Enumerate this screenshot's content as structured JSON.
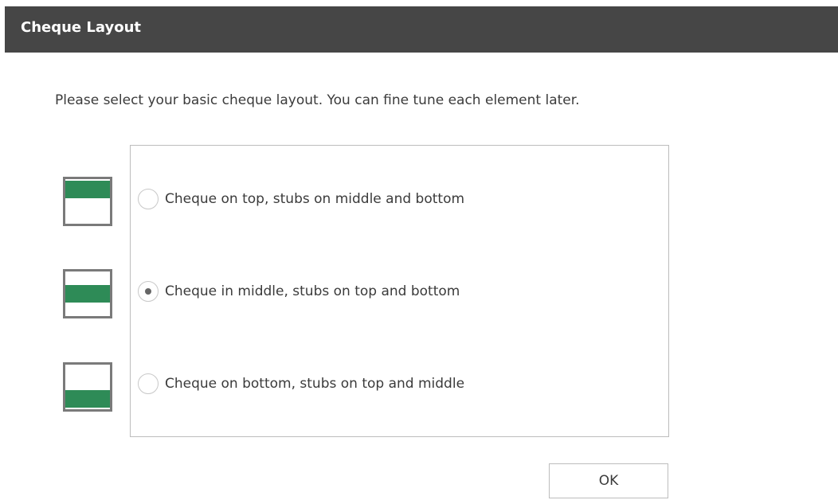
{
  "window": {
    "title": "Cheque Layout"
  },
  "instructions": "Please select your basic cheque layout. You can fine tune each element later.",
  "options": [
    {
      "label": "Cheque on top, stubs on middle and bottom",
      "selected": false,
      "icon": "cheque-top-layout-icon"
    },
    {
      "label": "Cheque in middle, stubs on top and bottom",
      "selected": true,
      "icon": "cheque-middle-layout-icon"
    },
    {
      "label": "Cheque on bottom, stubs on top and middle",
      "selected": false,
      "icon": "cheque-bottom-layout-icon"
    }
  ],
  "buttons": {
    "ok_label": "OK"
  },
  "colors": {
    "titlebar": "#464646",
    "cheque_band": "#2e8b57",
    "icon_border": "#7a7a7a"
  }
}
